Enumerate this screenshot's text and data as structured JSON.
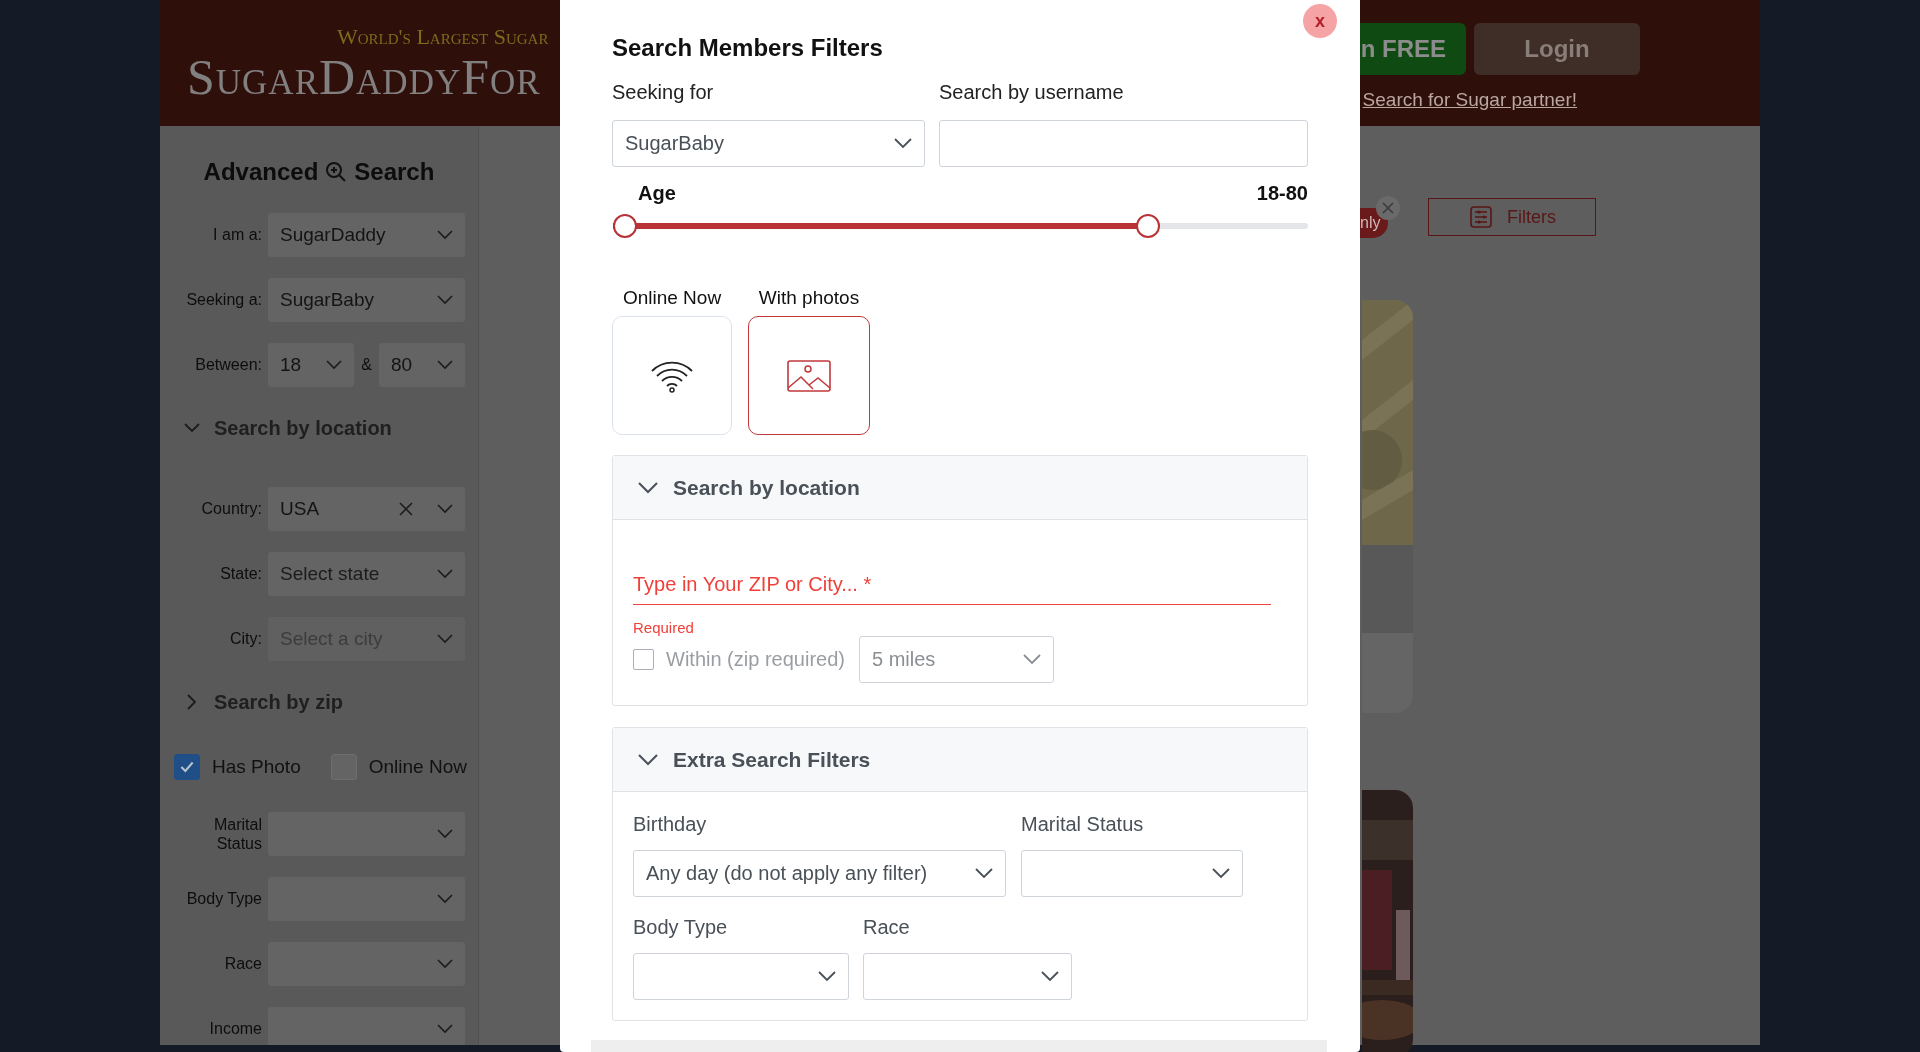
{
  "site_header": {
    "tagline": "World's Largest Sugar",
    "logo": "SugarDaddyFor",
    "join_button": "n FREE",
    "login_button": "Login",
    "link": "Search for Sugar partner!"
  },
  "sidebar": {
    "title_start": "Advanced",
    "title_end": "Search",
    "rows": [
      {
        "kind": "select",
        "label": "I am a:",
        "value": "SugarDaddy",
        "disabled": false
      },
      {
        "kind": "select",
        "label": "Seeking a:",
        "value": "SugarBaby",
        "disabled": false
      },
      {
        "kind": "range",
        "label": "Between:",
        "from": "18",
        "separator": "&",
        "to": "80"
      },
      {
        "kind": "section",
        "title": "Search by location",
        "expanded": true
      },
      {
        "kind": "select",
        "label": "Country:",
        "value": "USA",
        "clearable": true,
        "disabled": false
      },
      {
        "kind": "select",
        "label": "State:",
        "placeholder": "Select state",
        "disabled": false
      },
      {
        "kind": "select",
        "label": "City:",
        "placeholder": "Select a city",
        "disabled": true
      },
      {
        "kind": "section",
        "title": "Search by zip",
        "expanded": false
      },
      {
        "kind": "checks",
        "items": [
          {
            "label": "Has Photo",
            "checked": true
          },
          {
            "label": "Online Now",
            "checked": false
          }
        ]
      },
      {
        "kind": "select",
        "label": "Marital Status"
      },
      {
        "kind": "select",
        "label": "Body Type"
      },
      {
        "kind": "select",
        "label": "Race"
      },
      {
        "kind": "select",
        "label": "Income"
      }
    ]
  },
  "main": {
    "chip": "nly",
    "filters_button": "Filters"
  },
  "modal": {
    "title": "Search Members Filters",
    "close": "x",
    "seeking": {
      "label": "Seeking for",
      "value": "SugarBaby"
    },
    "username": {
      "label": "Search by username"
    },
    "age": {
      "label": "Age",
      "reading": "18-80",
      "level": 0.77
    },
    "toggles": [
      {
        "label": "Online Now",
        "selected": false
      },
      {
        "label": "With photos",
        "selected": true
      }
    ],
    "location": {
      "title": "Search by location",
      "expanded": true,
      "zip_placeholder": "Type in Your ZIP or City... *",
      "error": "Required",
      "within": {
        "label": "Within (zip required)",
        "checked": false
      },
      "distance": "5 miles"
    },
    "extra": {
      "title": "Extra Search Filters",
      "expanded": true,
      "fields": [
        {
          "label": "Birthday",
          "value": "Any day (do not apply any filter)"
        },
        {
          "label": "Marital Status"
        },
        {
          "label": "Body Type"
        },
        {
          "label": "Race"
        }
      ]
    }
  }
}
